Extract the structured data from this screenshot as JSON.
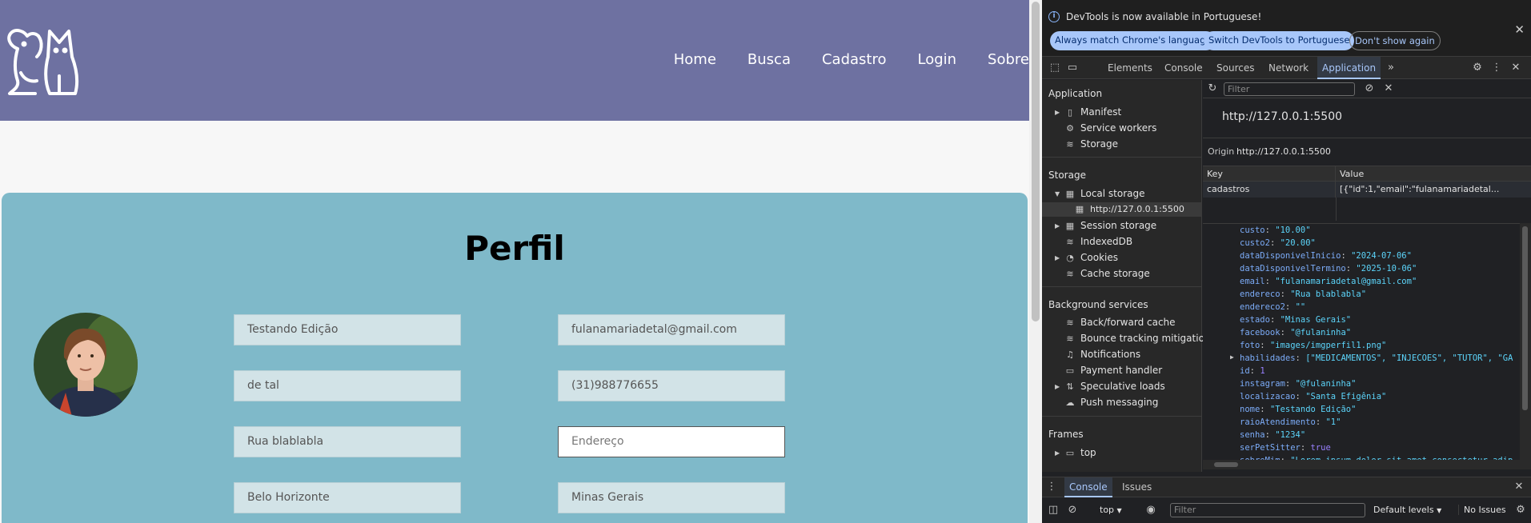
{
  "site": {
    "nav": [
      "Home",
      "Busca",
      "Cadastro",
      "Login",
      "Sobre"
    ],
    "profile_title": "Perfil",
    "fields_left": [
      "Testando Edição",
      "de tal",
      "Rua blablabla",
      "Belo Horizonte"
    ],
    "fields_right": [
      "fulanamariadetal@gmail.com",
      "(31)988776655",
      "",
      "Minas Gerais"
    ],
    "address_placeholder": "Endereço",
    "colors": {
      "header": "#6e71a1",
      "card": "#7fb9c9"
    }
  },
  "devtools": {
    "infobar": {
      "message": "DevTools is now available in Portuguese!",
      "btn_match": "Always match Chrome's language",
      "btn_switch": "Switch DevTools to Portuguese",
      "btn_dismiss": "Don't show again"
    },
    "tabs": [
      "Elements",
      "Console",
      "Sources",
      "Network",
      "Application"
    ],
    "active_tab": "Application",
    "sidebar": {
      "application_head": "Application",
      "application_items": [
        "Manifest",
        "Service workers",
        "Storage"
      ],
      "storage_head": "Storage",
      "local_storage": "Local storage",
      "local_origin": "http://127.0.0.1:5500",
      "storage_items": [
        "Session storage",
        "IndexedDB",
        "Cookies",
        "Cache storage"
      ],
      "background_head": "Background services",
      "background_items": [
        "Back/forward cache",
        "Bounce tracking mitigations",
        "Notifications",
        "Payment handler",
        "Speculative loads",
        "Push messaging"
      ],
      "frames_head": "Frames",
      "frames_top": "top"
    },
    "main": {
      "filter_placeholder": "Filter",
      "origin_title": "http://127.0.0.1:5500",
      "origin_label": "Origin",
      "origin_value": "http://127.0.0.1:5500",
      "col_key": "Key",
      "col_value": "Value",
      "row_key": "cadastros",
      "row_value": "[{\"id\":1,\"email\":\"fulanamariadetal...",
      "json": [
        {
          "k": "custo",
          "v": "\"10.00\""
        },
        {
          "k": "custo2",
          "v": "\"20.00\""
        },
        {
          "k": "dataDisponivelInicio",
          "v": "\"2024-07-06\""
        },
        {
          "k": "dataDisponivelTermino",
          "v": "\"2025-10-06\""
        },
        {
          "k": "email",
          "v": "\"fulanamariadetal@gmail.com\""
        },
        {
          "k": "endereco",
          "v": "\"Rua blablabla\""
        },
        {
          "k": "endereco2",
          "v": "\"\""
        },
        {
          "k": "estado",
          "v": "\"Minas Gerais\""
        },
        {
          "k": "facebook",
          "v": "\"@fulaninha\""
        },
        {
          "k": "foto",
          "v": "\"images/imgperfil1.png\""
        },
        {
          "k": "habilidades",
          "v": "[\"MEDICAMENTOS\", \"INJECOES\", \"TUTOR\", \"GA"
        },
        {
          "k": "id",
          "v": "1"
        },
        {
          "k": "instagram",
          "v": "\"@fulaninha\""
        },
        {
          "k": "localizacao",
          "v": "\"Santa Efigênia\""
        },
        {
          "k": "nome",
          "v": "\"Testando Edição\""
        },
        {
          "k": "raioAtendimento",
          "v": "\"1\""
        },
        {
          "k": "senha",
          "v": "\"1234\""
        },
        {
          "k": "serPetSitter",
          "v": "true"
        },
        {
          "k": "sobreMim",
          "v": "\"Lorem ipsum dolor sit amet consectetur adip"
        }
      ]
    },
    "drawer": {
      "tab_console": "Console",
      "tab_issues": "Issues",
      "context": "top",
      "filter_placeholder": "Filter",
      "levels": "Default levels",
      "issues": "No Issues"
    }
  }
}
